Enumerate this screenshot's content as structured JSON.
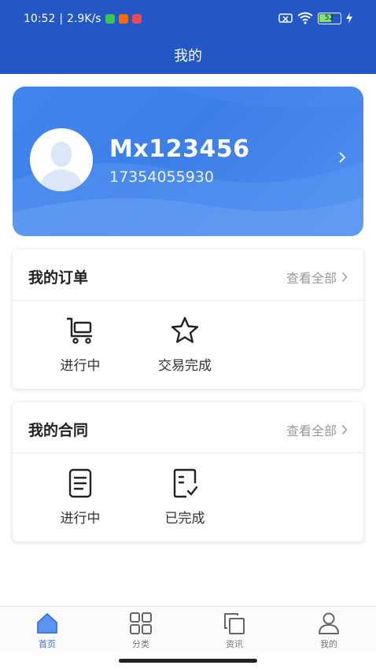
{
  "status_bar": {
    "time": "10:52",
    "speed": "2.9K/s",
    "battery": "52",
    "notif_icons": [
      "wechat-icon",
      "mi-icon",
      "app-icon"
    ]
  },
  "header": {
    "title": "我的"
  },
  "profile": {
    "username": "Mx123456",
    "phone": "17354055930"
  },
  "orders": {
    "title": "我的订单",
    "view_all": "查看全部",
    "items": [
      {
        "label": "进行中",
        "icon": "cart-icon"
      },
      {
        "label": "交易完成",
        "icon": "star-icon"
      }
    ]
  },
  "contracts": {
    "title": "我的合同",
    "view_all": "查看全部",
    "items": [
      {
        "label": "进行中",
        "icon": "document-icon"
      },
      {
        "label": "已完成",
        "icon": "document-check-icon"
      }
    ]
  },
  "tabbar": {
    "active": "首页",
    "tabs": [
      {
        "label": "首页",
        "icon": "home-icon"
      },
      {
        "label": "分类",
        "icon": "grid-icon"
      },
      {
        "label": "资讯",
        "icon": "copy-icon"
      },
      {
        "label": "我的",
        "icon": "user-icon"
      }
    ]
  },
  "colors": {
    "header_bg": "#2357c6",
    "card_bg": "#3f86ee",
    "accent": "#3573e0",
    "muted": "#9a9a9a"
  }
}
